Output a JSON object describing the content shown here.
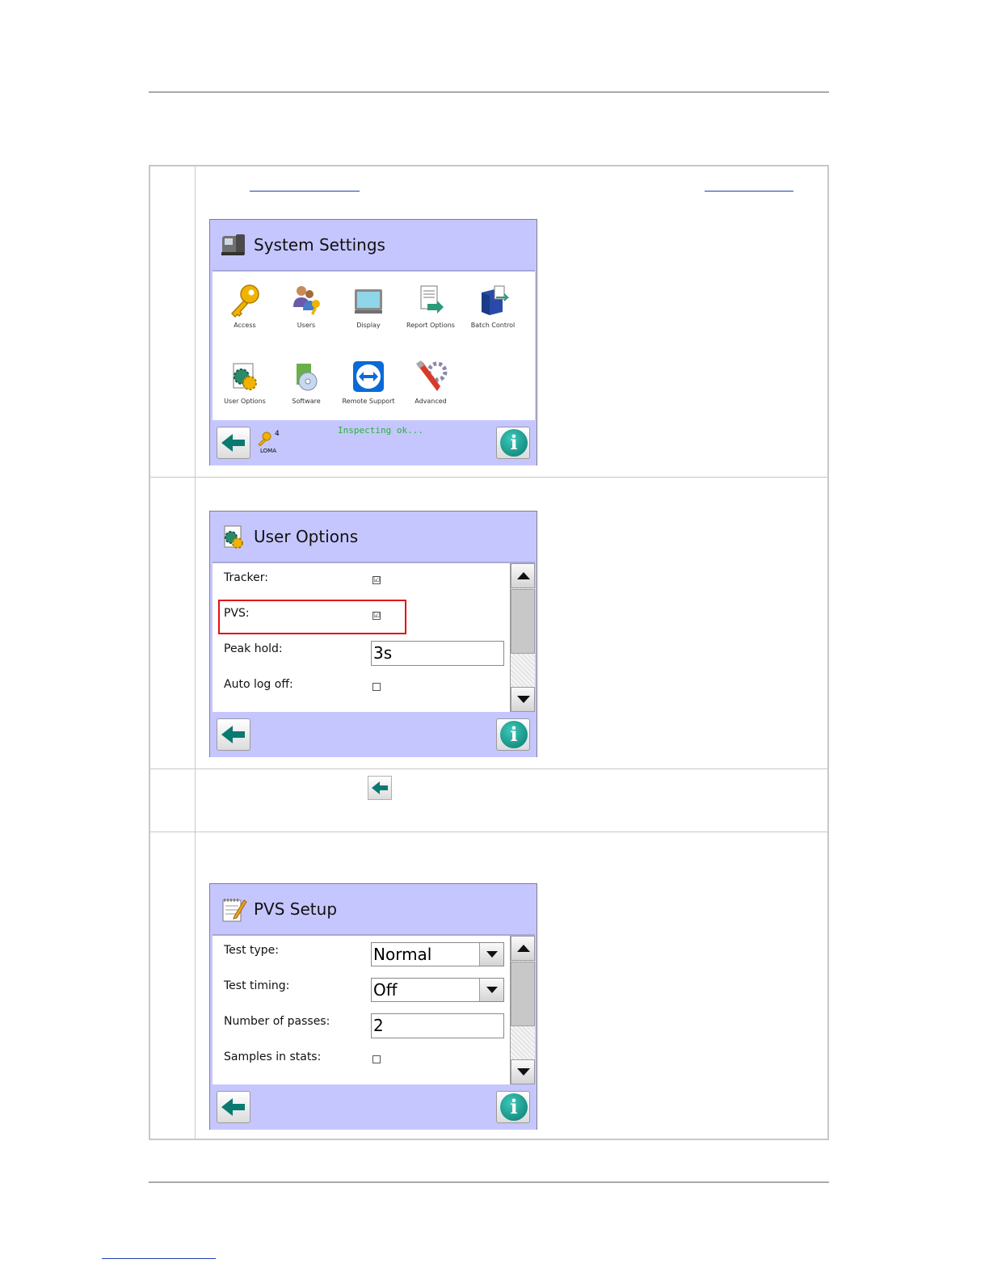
{
  "screens": {
    "system_settings": {
      "title": "System Settings",
      "icons": [
        {
          "label": "Access",
          "icon": "key-icon"
        },
        {
          "label": "Users",
          "icon": "users-icon"
        },
        {
          "label": "Display",
          "icon": "monitor-icon"
        },
        {
          "label": "Report Options",
          "icon": "report-icon"
        },
        {
          "label": "Batch Control",
          "icon": "batch-icon"
        },
        {
          "label": "User Options",
          "icon": "user-options-icon"
        },
        {
          "label": "Software",
          "icon": "software-icon"
        },
        {
          "label": "Remote Support",
          "icon": "remote-support-icon"
        },
        {
          "label": "Advanced",
          "icon": "advanced-icon"
        }
      ],
      "status": "Inspecting ok...",
      "access_level": "4",
      "user": "LOMA"
    },
    "user_options": {
      "title": "User Options",
      "tracker_label": "Tracker:",
      "pvs_label": "PVS:",
      "peak_hold_label": "Peak hold:",
      "peak_hold_value": "3s",
      "auto_log_off_label": "Auto log off:",
      "check_mark": "☑",
      "tracker_checked": true,
      "pvs_checked": true,
      "auto_log_off_checked": false
    },
    "pvs_setup": {
      "title": "PVS Setup",
      "test_type_label": "Test type:",
      "test_type_value": "Normal",
      "test_timing_label": "Test timing:",
      "test_timing_value": "Off",
      "passes_label": "Number of passes:",
      "passes_value": "2",
      "samples_label": "Samples in stats:",
      "samples_checked": false
    }
  },
  "colors": {
    "screen_bg": "#c6c6ff",
    "status_text": "#27b334",
    "highlight": "#e01010",
    "link": "#1f3fb3"
  }
}
